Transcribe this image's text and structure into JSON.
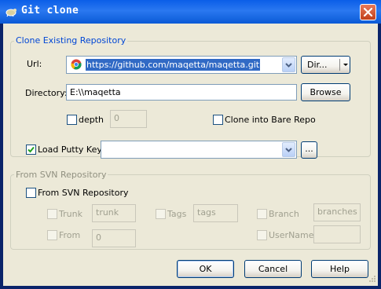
{
  "window": {
    "title": "Git clone"
  },
  "clone_group": {
    "legend": "Clone Existing Repository",
    "url_label": "Url:",
    "url_value": "https://github.com/maqetta/maqetta.git",
    "dir_button": "Dir...",
    "directory_label": "Directory:",
    "directory_value": "E:\\\\maqetta",
    "browse_button": "Browse",
    "depth_label": "depth",
    "depth_value": "0",
    "bare_label": "Clone into Bare Repo"
  },
  "putty": {
    "label": "Load Putty Key",
    "value": "",
    "browse_button": "..."
  },
  "svn_group": {
    "legend": "From SVN Repository",
    "from_svn_label": "From SVN Repository",
    "trunk_label": "Trunk",
    "trunk_value": "trunk",
    "tags_label": "Tags",
    "tags_value": "tags",
    "branch_label": "Branch",
    "branch_value": "branches",
    "from_label": "From",
    "from_value": "0",
    "username_label": "UserName",
    "username_value": ""
  },
  "buttons": {
    "ok": "OK",
    "cancel": "Cancel",
    "help": "Help"
  },
  "colors": {
    "title_bar": "#0b5ee8",
    "dialog_bg": "#ece9d8",
    "legend": "#0046d5",
    "selection": "#316ac5"
  }
}
